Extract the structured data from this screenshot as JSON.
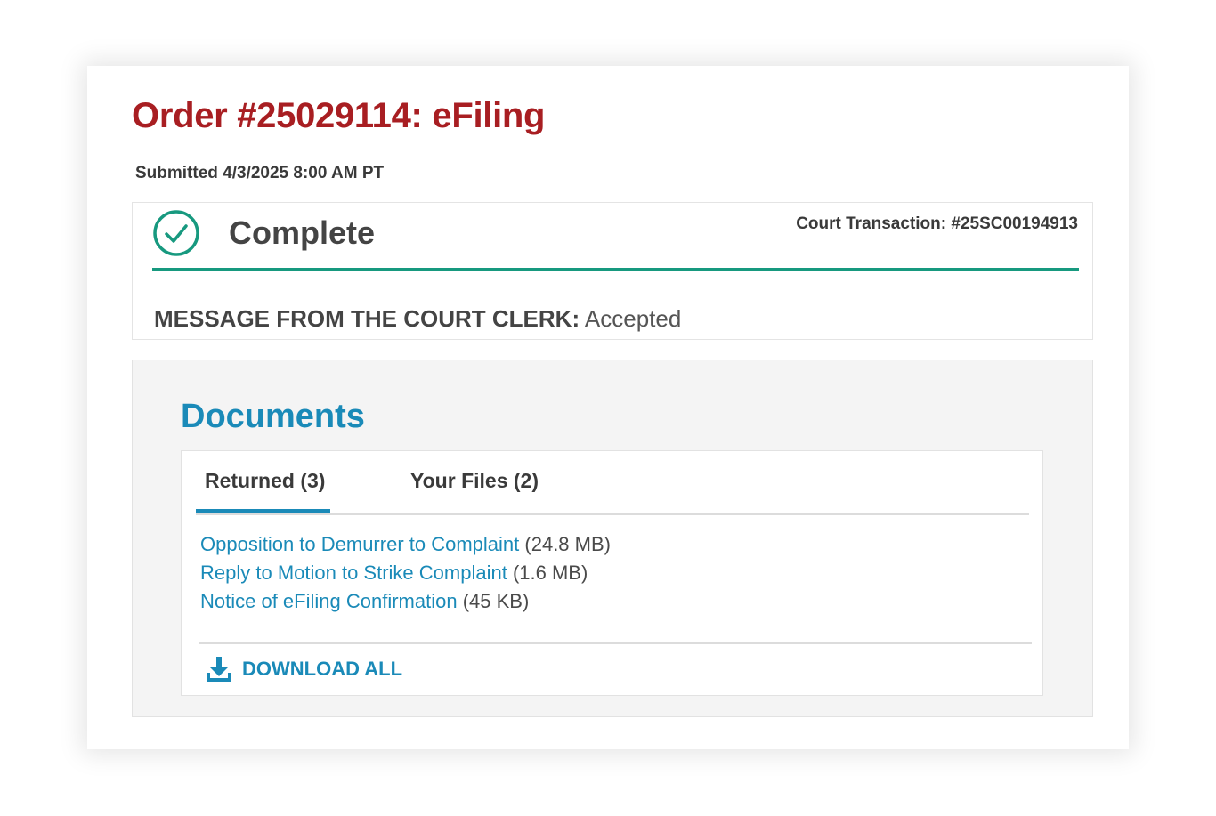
{
  "order": {
    "title": "Order #25029114: eFiling",
    "submitted": "Submitted 4/3/2025 8:00 AM PT"
  },
  "status": {
    "label": "Complete",
    "icon": "check-circle-icon",
    "court_transaction": "Court Transaction: #25SC00194913",
    "clerk_label": "MESSAGE FROM THE COURT CLERK:",
    "clerk_value": "Accepted"
  },
  "documents": {
    "title": "Documents",
    "tabs": [
      {
        "label": "Returned (3)",
        "active": true
      },
      {
        "label": "Your Files (2)",
        "active": false
      }
    ],
    "files": [
      {
        "name": "Opposition to Demurrer to Complaint",
        "size": "(24.8 MB)"
      },
      {
        "name": "Reply to Motion to Strike Complaint",
        "size": "(1.6 MB)"
      },
      {
        "name": "Notice of eFiling Confirmation",
        "size": "(45 KB)"
      }
    ],
    "download_all_label": "DOWNLOAD ALL",
    "download_icon": "download-icon"
  },
  "colors": {
    "title_red": "#a81e22",
    "accent_blue": "#1a8ab8",
    "status_green": "#17997f"
  }
}
